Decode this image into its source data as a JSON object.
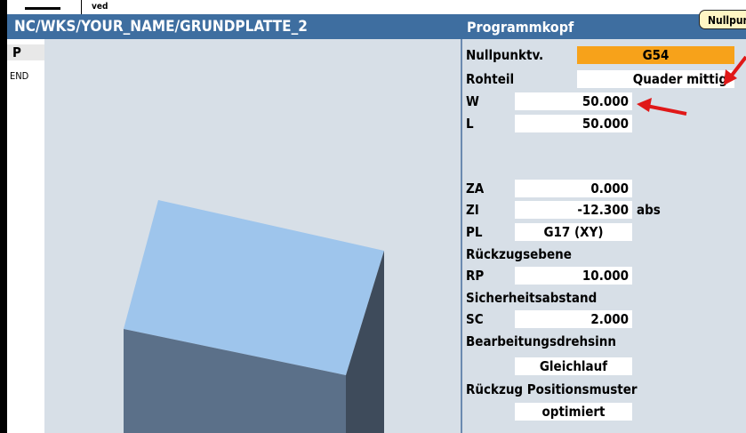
{
  "top": {
    "tab_stub": "ved"
  },
  "title_bar": {
    "path": "NC/WKS/YOUR_NAME/GRUNDPLATTE_2",
    "section": "Programmkopf",
    "tooltip": "Nullpunk"
  },
  "program_list": {
    "items": [
      "P",
      "END"
    ]
  },
  "form": {
    "nullpunkt": {
      "label": "Nullpunktv.",
      "value": "G54"
    },
    "rohteil": {
      "label": "Rohteil",
      "value": "Quader mittig"
    },
    "w": {
      "label": "W",
      "value": "50.000"
    },
    "l": {
      "label": "L",
      "value": "50.000"
    },
    "za": {
      "label": "ZA",
      "value": "0.000"
    },
    "zi": {
      "label": "ZI",
      "value": "-12.300",
      "unit": "abs"
    },
    "pl": {
      "label": "PL",
      "value": "G17 (XY)"
    },
    "rueckzugsebene": {
      "label": "Rückzugsebene"
    },
    "rp": {
      "label": "RP",
      "value": "10.000"
    },
    "sicherheitsabstand": {
      "label": "Sicherheitsabstand"
    },
    "sc": {
      "label": "SC",
      "value": "2.000"
    },
    "bearbeitungsdrehsinn": {
      "label": "Bearbeitungsdrehsinn",
      "value": "Gleichlauf"
    },
    "rueckzug_positionsmuster": {
      "label": "Rückzug Positionsmuster",
      "value": "optimiert"
    }
  },
  "colors": {
    "title_bar": "#3e6ea0",
    "panel_bg": "#d7dfe7",
    "highlight": "#f7a21a",
    "cube_top": "#9ec5ec",
    "cube_front": "#5b7089",
    "cube_side": "#3e4b5b",
    "annotation_arrow": "#e01818"
  },
  "icons": {
    "annotation": "red-arrow-icon"
  }
}
